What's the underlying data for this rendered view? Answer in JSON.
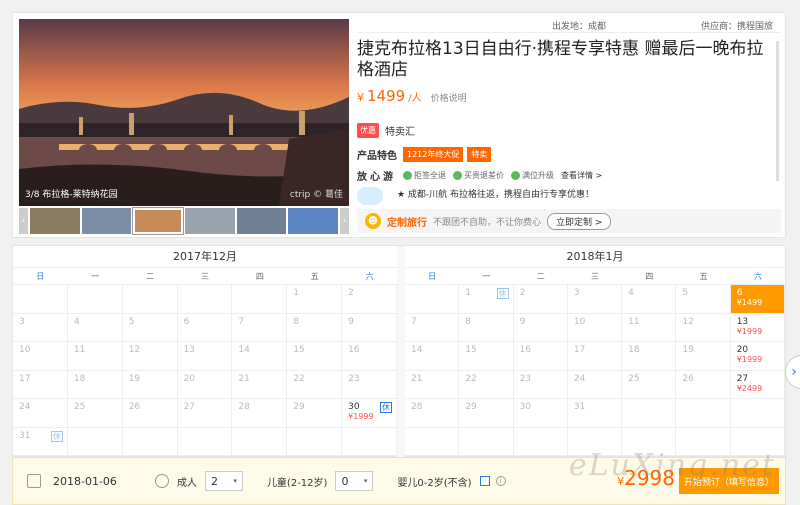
{
  "product": {
    "departure": "出发地：成都",
    "supplier": "供应商：携程国旅",
    "title": "捷克布拉格13日自由行·携程专享特惠 赠最后一晚布拉格酒店",
    "price_currency": "¥",
    "price": "1499",
    "price_unit": "/人",
    "price_note": "价格说明",
    "promo_tag": "优惠",
    "promo_text": "特卖汇",
    "feature_label": "产品特色",
    "feature_tags": [
      "1212年终大促",
      "特卖"
    ],
    "worry_label": "放心游",
    "worry_items": [
      "拒签全退",
      "买贵退差价",
      "满位升级"
    ],
    "worry_link": "查看详情 >",
    "highlight": "★ 成都-川航 布拉格往返，携程自由行专享优惠！",
    "custom_title": "定制旅行",
    "custom_desc": "不跟团不自助，不让你费心",
    "custom_button": "立即定制 >"
  },
  "gallery": {
    "caption": "3/8 布拉格-莱特纳花园",
    "credit": "ctrip © 葛佳",
    "prev_icon": "chevron-left-icon",
    "next_icon": "chevron-right-icon",
    "thumb_colors": [
      "#8a7a60",
      "#7a8ea8",
      "#c58a55",
      "#9aa3ad",
      "#6e7f96",
      "#5c86c2"
    ]
  },
  "calendar": {
    "weekdays": [
      "日",
      "一",
      "二",
      "三",
      "四",
      "五",
      "六"
    ],
    "months": [
      {
        "title": "2017年12月",
        "rows": [
          [
            {
              "d": ""
            },
            {
              "d": ""
            },
            {
              "d": ""
            },
            {
              "d": ""
            },
            {
              "d": ""
            },
            {
              "d": "1"
            },
            {
              "d": "2"
            }
          ],
          [
            {
              "d": "3"
            },
            {
              "d": "4"
            },
            {
              "d": "5"
            },
            {
              "d": "6"
            },
            {
              "d": "7"
            },
            {
              "d": "8"
            },
            {
              "d": "9"
            }
          ],
          [
            {
              "d": "10"
            },
            {
              "d": "11"
            },
            {
              "d": "12"
            },
            {
              "d": "13"
            },
            {
              "d": "14"
            },
            {
              "d": "15"
            },
            {
              "d": "16"
            }
          ],
          [
            {
              "d": "17"
            },
            {
              "d": "18"
            },
            {
              "d": "19"
            },
            {
              "d": "20"
            },
            {
              "d": "21"
            },
            {
              "d": "22"
            },
            {
              "d": "23"
            }
          ],
          [
            {
              "d": "24"
            },
            {
              "d": "25"
            },
            {
              "d": "26"
            },
            {
              "d": "27"
            },
            {
              "d": "28"
            },
            {
              "d": "29"
            },
            {
              "d": "30",
              "p": "¥1999",
              "h": "休",
              "av": true
            }
          ],
          [
            {
              "d": "31",
              "h": "休"
            },
            {
              "d": ""
            },
            {
              "d": ""
            },
            {
              "d": ""
            },
            {
              "d": ""
            },
            {
              "d": ""
            },
            {
              "d": ""
            }
          ]
        ]
      },
      {
        "title": "2018年1月",
        "rows": [
          [
            {
              "d": ""
            },
            {
              "d": "1",
              "h": "休"
            },
            {
              "d": "2"
            },
            {
              "d": "3"
            },
            {
              "d": "4"
            },
            {
              "d": "5"
            },
            {
              "d": "6",
              "p": "¥1499",
              "av": true,
              "sel": true
            }
          ],
          [
            {
              "d": "7"
            },
            {
              "d": "8"
            },
            {
              "d": "9"
            },
            {
              "d": "10"
            },
            {
              "d": "11"
            },
            {
              "d": "12"
            },
            {
              "d": "13",
              "p": "¥1999",
              "av": true
            }
          ],
          [
            {
              "d": "14"
            },
            {
              "d": "15"
            },
            {
              "d": "16"
            },
            {
              "d": "17"
            },
            {
              "d": "18"
            },
            {
              "d": "19"
            },
            {
              "d": "20",
              "p": "¥1999",
              "av": true
            }
          ],
          [
            {
              "d": "21"
            },
            {
              "d": "22"
            },
            {
              "d": "23"
            },
            {
              "d": "24"
            },
            {
              "d": "25"
            },
            {
              "d": "26"
            },
            {
              "d": "27",
              "p": "¥2499",
              "av": true
            }
          ],
          [
            {
              "d": "28"
            },
            {
              "d": "29"
            },
            {
              "d": "30"
            },
            {
              "d": "31"
            },
            {
              "d": ""
            },
            {
              "d": ""
            },
            {
              "d": ""
            }
          ],
          [
            {
              "d": ""
            },
            {
              "d": ""
            },
            {
              "d": ""
            },
            {
              "d": ""
            },
            {
              "d": ""
            },
            {
              "d": ""
            },
            {
              "d": ""
            }
          ]
        ]
      }
    ]
  },
  "booking": {
    "date": "2018-01-06",
    "adult_label": "成人",
    "adult_value": "2",
    "child_label": "儿童(2-12岁)",
    "child_value": "0",
    "infant_label": "婴儿0-2岁(不含)",
    "total_currency": "¥",
    "total": "2998",
    "book_button": "开始预订（填写信息）",
    "watermark": "eLuXing.net"
  },
  "colors": {
    "accent": "#ff6600",
    "selected": "#ff9900",
    "weekend": "#2c7be5"
  }
}
